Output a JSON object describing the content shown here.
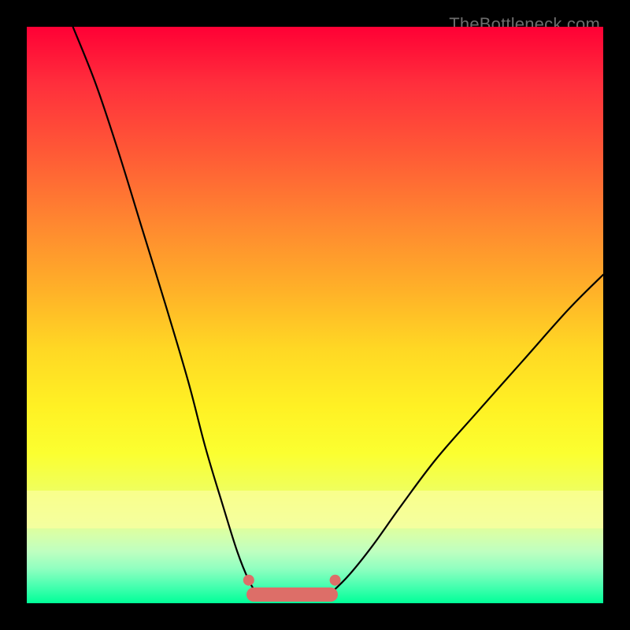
{
  "watermark": "TheBottleneck.com",
  "chart_data": {
    "type": "line",
    "title": "",
    "xlabel": "",
    "ylabel": "",
    "xlim": [
      0,
      100
    ],
    "ylim": [
      0,
      100
    ],
    "grid": false,
    "legend": false,
    "background_gradient": {
      "direction": "vertical",
      "stops": [
        {
          "pos": 0,
          "color": "#ff0035"
        },
        {
          "pos": 22,
          "color": "#ff5a36"
        },
        {
          "pos": 46,
          "color": "#ffb228"
        },
        {
          "pos": 66,
          "color": "#fff124"
        },
        {
          "pos": 85,
          "color": "#e6ff8a"
        },
        {
          "pos": 100,
          "color": "#00ff98"
        }
      ]
    },
    "overlays": {
      "light_band_y_range": [
        13,
        19.5
      ]
    },
    "series": [
      {
        "name": "curve-left",
        "x": [
          8,
          12,
          16,
          20,
          24,
          28,
          31,
          34,
          36.5,
          38.5,
          40,
          41
        ],
        "y": [
          100,
          90,
          78,
          65,
          52,
          38.5,
          27,
          17,
          9,
          4,
          1.5,
          0.5
        ]
      },
      {
        "name": "curve-right",
        "x": [
          51,
          53,
          56,
          60,
          65,
          71,
          78,
          86,
          94,
          100
        ],
        "y": [
          0.5,
          2,
          5,
          10,
          17,
          25,
          33,
          42,
          51,
          57
        ]
      },
      {
        "name": "bottom-segment",
        "type": "segment",
        "color": "#dd6e68",
        "x_start": 38.5,
        "x_end": 53.5,
        "y": 1.5,
        "endpoints": [
          {
            "x": 38.5,
            "y": 4
          },
          {
            "x": 53.5,
            "y": 4
          }
        ]
      }
    ]
  }
}
